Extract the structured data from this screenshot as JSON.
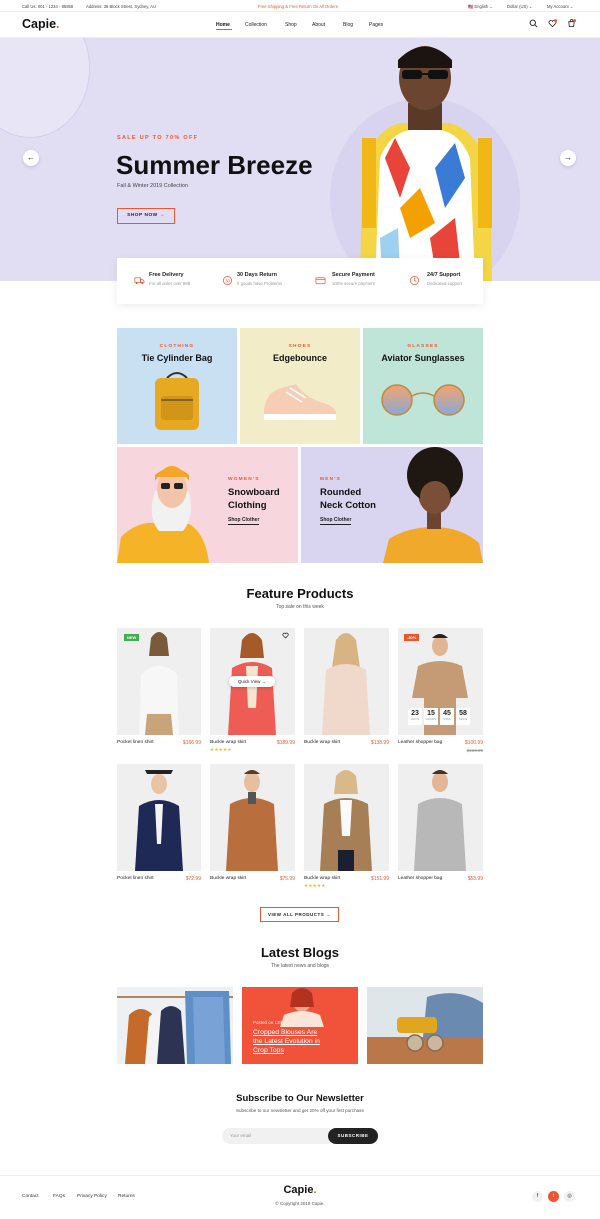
{
  "topbar": {
    "call": "Call Us: 001 - 1234 - 85858",
    "address": "Address: 38 Block Street, Sydney, AU",
    "promo": "Free Shipping & Free Return On All Orders",
    "language": "English",
    "currency": "Dollar (US)",
    "account": "My Account"
  },
  "header": {
    "logo": "Capie",
    "logo_dot": ".",
    "nav": [
      "Home",
      "Collection",
      "Shop",
      "About",
      "Blog",
      "Pages"
    ]
  },
  "hero": {
    "small": "SALE UP TO 70% OFF",
    "title": "Summer Breeze",
    "subtitle": "Fall & Winter 2019 Collection",
    "button": "SHOP NOW →",
    "prev": "←",
    "next": "→"
  },
  "features": [
    {
      "title": "Free Delivery",
      "sub": "For all order over 99$"
    },
    {
      "title": "30 Days Return",
      "sub": "If goods have Problems"
    },
    {
      "title": "Secure Payment",
      "sub": "100% secure payment"
    },
    {
      "title": "24/7 Support",
      "sub": "Dedicated support"
    }
  ],
  "categories": [
    {
      "cat": "CLOTHING",
      "name": "Tie Cylinder Bag"
    },
    {
      "cat": "SHOES",
      "name": "Edgebounce"
    },
    {
      "cat": "GLASSES",
      "name": "Aviator Sunglasses"
    }
  ],
  "promos": [
    {
      "cat": "WOMEN'S",
      "line1": "Snowboard",
      "line2": "Clothing",
      "link": "Shop Clother"
    },
    {
      "cat": "MEN'S",
      "line1": "Rounded",
      "line2": "Neck Cotton",
      "link": "Shop Clother"
    }
  ],
  "featured": {
    "title": "Feature Products",
    "subtitle": "Top sale on this week",
    "quick_view": "Quick View →",
    "countdown": [
      {
        "n": "23",
        "l": "DAYS"
      },
      {
        "n": "15",
        "l": "HOURS"
      },
      {
        "n": "45",
        "l": "MINS"
      },
      {
        "n": "58",
        "l": "SECS"
      }
    ],
    "products": [
      {
        "name": "Pocket linen shirt",
        "price": "$166.99",
        "badge": "NEW"
      },
      {
        "name": "Buckle wrap skirt",
        "price": "$189.99",
        "stars": "★★★★★"
      },
      {
        "name": "Buckle wrap skirt",
        "price": "$138.99"
      },
      {
        "name": "Leather shopper bag",
        "price": "$100.99",
        "old": "$138.99",
        "badge": "-30%"
      },
      {
        "name": "Pocket linen shirt",
        "price": "$72.99"
      },
      {
        "name": "Buckle wrap skirt",
        "price": "$75.99"
      },
      {
        "name": "Buckle wrap skirt",
        "price": "$151.99",
        "stars": "★★★★★"
      },
      {
        "name": "Leather shopper bag",
        "price": "$53.99"
      }
    ],
    "view_all": "VIEW ALL PRODUCTS →"
  },
  "blogs": {
    "title": "Latest Blogs",
    "subtitle": "The latest news and blogs",
    "feature_date": "Posted on 13th Jan 2019",
    "feature_line1": "Cropped Blouses Are",
    "feature_line2": "the Latest Evolution in",
    "feature_line3": "Crop Tops"
  },
  "newsletter": {
    "title": "Subscribe to Our Newsletter",
    "subtitle": "Subscribe to our newsletter and get 20% off your first purchase",
    "placeholder": "Your email",
    "button": "SUBSCRIBE"
  },
  "footer": {
    "links": [
      "Contact",
      "FAQs",
      "Privacy Policy",
      "Returns"
    ],
    "logo": "Capie",
    "logo_dot": ".",
    "copyright": "© Copyright 2019 Capie.",
    "social": [
      "f",
      "t",
      "◎"
    ]
  },
  "colors": {
    "accent": "#f0542d",
    "hero_bg": "#e1ddf3",
    "tile_blue": "#c9dff2",
    "tile_yellow": "#f3ecc9",
    "tile_green": "#bfe4d8",
    "tile_pink": "#f7d6dd",
    "tile_lavender": "#d9d4ef"
  }
}
